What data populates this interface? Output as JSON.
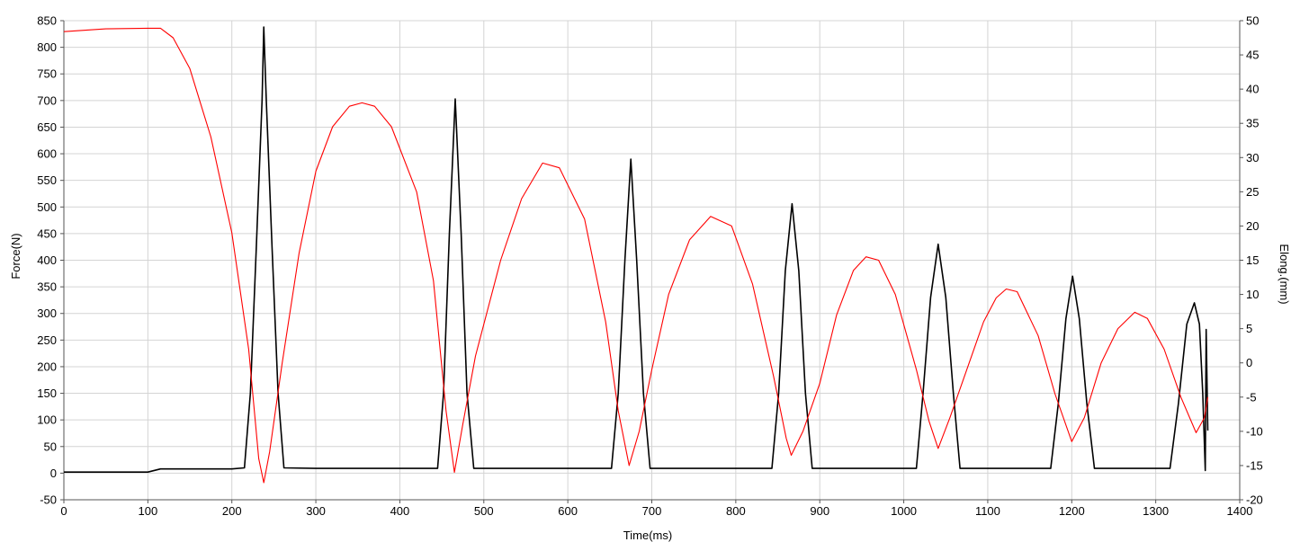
{
  "chart_data": {
    "type": "line",
    "xlabel": "Time(ms)",
    "ylabel_left": "Force(N)",
    "ylabel_right": "Elong.(mm)",
    "xlim": [
      0,
      1400
    ],
    "ylim_left": [
      -50,
      850
    ],
    "ylim_right": [
      -20,
      50
    ],
    "x_ticks": [
      0,
      100,
      200,
      300,
      400,
      500,
      600,
      700,
      800,
      900,
      1000,
      1100,
      1200,
      1300,
      1400
    ],
    "y_left_ticks": [
      -50,
      0,
      50,
      100,
      150,
      200,
      250,
      300,
      350,
      400,
      450,
      500,
      550,
      600,
      650,
      700,
      750,
      800,
      850
    ],
    "y_right_ticks": [
      -20,
      -15,
      -10,
      -5,
      0,
      5,
      10,
      15,
      20,
      25,
      30,
      35,
      40,
      45,
      50
    ],
    "grid": true,
    "series": [
      {
        "color": "#000000",
        "axis": "left",
        "points": [
          [
            0,
            2
          ],
          [
            40,
            2
          ],
          [
            100,
            2
          ],
          [
            115,
            8
          ],
          [
            150,
            8
          ],
          [
            200,
            8
          ],
          [
            215,
            10
          ],
          [
            222,
            150
          ],
          [
            229,
            420
          ],
          [
            236,
            700
          ],
          [
            238,
            838
          ],
          [
            241,
            700
          ],
          [
            248,
            420
          ],
          [
            255,
            150
          ],
          [
            262,
            10
          ],
          [
            300,
            9
          ],
          [
            350,
            9
          ],
          [
            400,
            9
          ],
          [
            445,
            9
          ],
          [
            452,
            150
          ],
          [
            459,
            450
          ],
          [
            466,
            703
          ],
          [
            473,
            450
          ],
          [
            480,
            150
          ],
          [
            488,
            9
          ],
          [
            550,
            9
          ],
          [
            600,
            9
          ],
          [
            652,
            9
          ],
          [
            660,
            150
          ],
          [
            668,
            400
          ],
          [
            675,
            590
          ],
          [
            682,
            400
          ],
          [
            690,
            150
          ],
          [
            698,
            9
          ],
          [
            750,
            9
          ],
          [
            800,
            9
          ],
          [
            843,
            9
          ],
          [
            851,
            150
          ],
          [
            859,
            380
          ],
          [
            867,
            506
          ],
          [
            875,
            380
          ],
          [
            883,
            150
          ],
          [
            891,
            9
          ],
          [
            950,
            9
          ],
          [
            1015,
            9
          ],
          [
            1023,
            150
          ],
          [
            1032,
            330
          ],
          [
            1041,
            430
          ],
          [
            1050,
            330
          ],
          [
            1059,
            150
          ],
          [
            1067,
            9
          ],
          [
            1120,
            9
          ],
          [
            1175,
            9
          ],
          [
            1184,
            130
          ],
          [
            1193,
            290
          ],
          [
            1201,
            370
          ],
          [
            1209,
            290
          ],
          [
            1218,
            130
          ],
          [
            1227,
            9
          ],
          [
            1280,
            9
          ],
          [
            1317,
            9
          ],
          [
            1327,
            130
          ],
          [
            1337,
            280
          ],
          [
            1346,
            320
          ],
          [
            1352,
            280
          ],
          [
            1356,
            150
          ],
          [
            1359,
            5
          ],
          [
            1360,
            270
          ],
          [
            1362,
            80
          ]
        ]
      },
      {
        "color": "#ff0000",
        "axis": "right",
        "points": [
          [
            0,
            48.4
          ],
          [
            50,
            48.8
          ],
          [
            100,
            48.9
          ],
          [
            115,
            48.9
          ],
          [
            130,
            47.5
          ],
          [
            150,
            43
          ],
          [
            175,
            33
          ],
          [
            200,
            19
          ],
          [
            220,
            2
          ],
          [
            232,
            -14
          ],
          [
            238,
            -17.5
          ],
          [
            245,
            -13
          ],
          [
            260,
            0
          ],
          [
            280,
            16
          ],
          [
            300,
            28
          ],
          [
            320,
            34.5
          ],
          [
            340,
            37.5
          ],
          [
            355,
            38
          ],
          [
            370,
            37.5
          ],
          [
            390,
            34.5
          ],
          [
            420,
            25
          ],
          [
            440,
            12
          ],
          [
            455,
            -7
          ],
          [
            465,
            -16
          ],
          [
            475,
            -9
          ],
          [
            490,
            1
          ],
          [
            520,
            15
          ],
          [
            545,
            24
          ],
          [
            570,
            29.2
          ],
          [
            590,
            28.5
          ],
          [
            620,
            21
          ],
          [
            645,
            6
          ],
          [
            660,
            -7
          ],
          [
            673,
            -15
          ],
          [
            685,
            -10
          ],
          [
            700,
            -1
          ],
          [
            720,
            10
          ],
          [
            745,
            18
          ],
          [
            770,
            21.4
          ],
          [
            795,
            20
          ],
          [
            820,
            11.5
          ],
          [
            845,
            -2
          ],
          [
            860,
            -11
          ],
          [
            866,
            -13.5
          ],
          [
            880,
            -10
          ],
          [
            900,
            -3
          ],
          [
            920,
            7
          ],
          [
            940,
            13.5
          ],
          [
            955,
            15.5
          ],
          [
            970,
            15
          ],
          [
            990,
            10
          ],
          [
            1015,
            -1
          ],
          [
            1030,
            -8.5
          ],
          [
            1041,
            -12.5
          ],
          [
            1055,
            -8
          ],
          [
            1075,
            -1
          ],
          [
            1095,
            6
          ],
          [
            1110,
            9.5
          ],
          [
            1122,
            10.8
          ],
          [
            1135,
            10.4
          ],
          [
            1160,
            4
          ],
          [
            1180,
            -4.5
          ],
          [
            1200,
            -11.5
          ],
          [
            1215,
            -8
          ],
          [
            1235,
            0
          ],
          [
            1255,
            5
          ],
          [
            1275,
            7.4
          ],
          [
            1290,
            6.5
          ],
          [
            1310,
            2
          ],
          [
            1330,
            -5
          ],
          [
            1348,
            -10.2
          ],
          [
            1358,
            -8
          ],
          [
            1362,
            -5
          ]
        ]
      }
    ]
  }
}
